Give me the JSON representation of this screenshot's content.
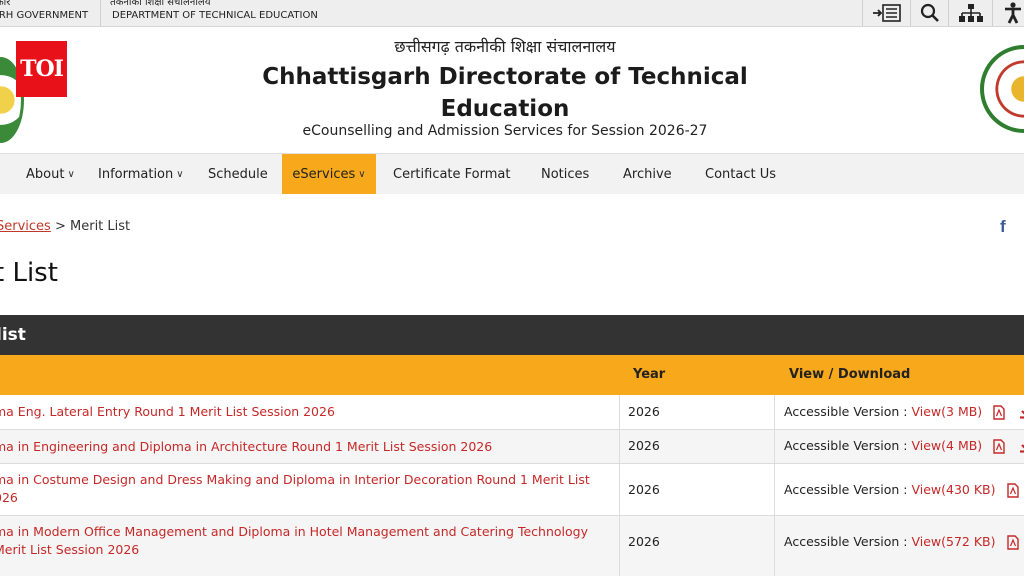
{
  "topbar": {
    "gov_hindi": "कार",
    "gov_english": "ARH GOVERNMENT",
    "dept_hindi": "तकनीकी शिक्षा संचालनालय",
    "dept_english": "DEPARTMENT OF TECHNICAL EDUCATION",
    "tools": [
      "skip-to-content-icon",
      "search-icon",
      "sitemap-icon",
      "accessibility-icon"
    ]
  },
  "header": {
    "badge": "TOI",
    "title_hindi": "छत्तीसगढ़ तकनीकी शिक्षा संचालनालय",
    "title_line1": "Chhattisgarh Directorate of Technical",
    "title_line2": "Education",
    "subtitle": "eCounselling and Admission Services for Session 2026-27"
  },
  "nav": {
    "items": [
      {
        "label": "About",
        "dropdown": true
      },
      {
        "label": "Information",
        "dropdown": true
      },
      {
        "label": "Schedule",
        "dropdown": false
      },
      {
        "label": "eServices",
        "dropdown": true,
        "active": true
      },
      {
        "label": "Certificate Format",
        "dropdown": false
      },
      {
        "label": "Notices",
        "dropdown": false
      },
      {
        "label": "Archive",
        "dropdown": false
      },
      {
        "label": "Contact Us",
        "dropdown": false
      }
    ]
  },
  "breadcrumb": {
    "parent": "Services",
    "separator": ">",
    "current": "Merit List"
  },
  "page": {
    "title": "t List"
  },
  "table": {
    "section_title": "list",
    "headers": {
      "year": "Year",
      "view": "View / Download"
    },
    "view_prefix": "Accessible Version :",
    "rows": [
      {
        "name_line1": "ma Eng. Lateral Entry Round 1 Merit List Session 2026",
        "name_line2": "",
        "year": "2026",
        "view": "View(3 MB)"
      },
      {
        "name_line1": "ma in Engineering and Diploma in Architecture Round 1 Merit List Session 2026",
        "name_line2": "",
        "year": "2026",
        "view": "View(4 MB)"
      },
      {
        "name_line1": "ma in Costume Design and Dress Making and Diploma in Interior Decoration Round 1 Merit List",
        "name_line2": "026",
        "year": "2026",
        "view": "View(430 KB)"
      },
      {
        "name_line1": "ma in Modern Office Management and Diploma in Hotel Management and Catering Technology",
        "name_line2": "Merit List Session 2026",
        "year": "2026",
        "view": "View(572 KB)"
      }
    ]
  },
  "colors": {
    "accent": "#f7a81b",
    "link_red": "#c62828",
    "dark_band": "#333333",
    "badge_red": "#e8111a"
  }
}
